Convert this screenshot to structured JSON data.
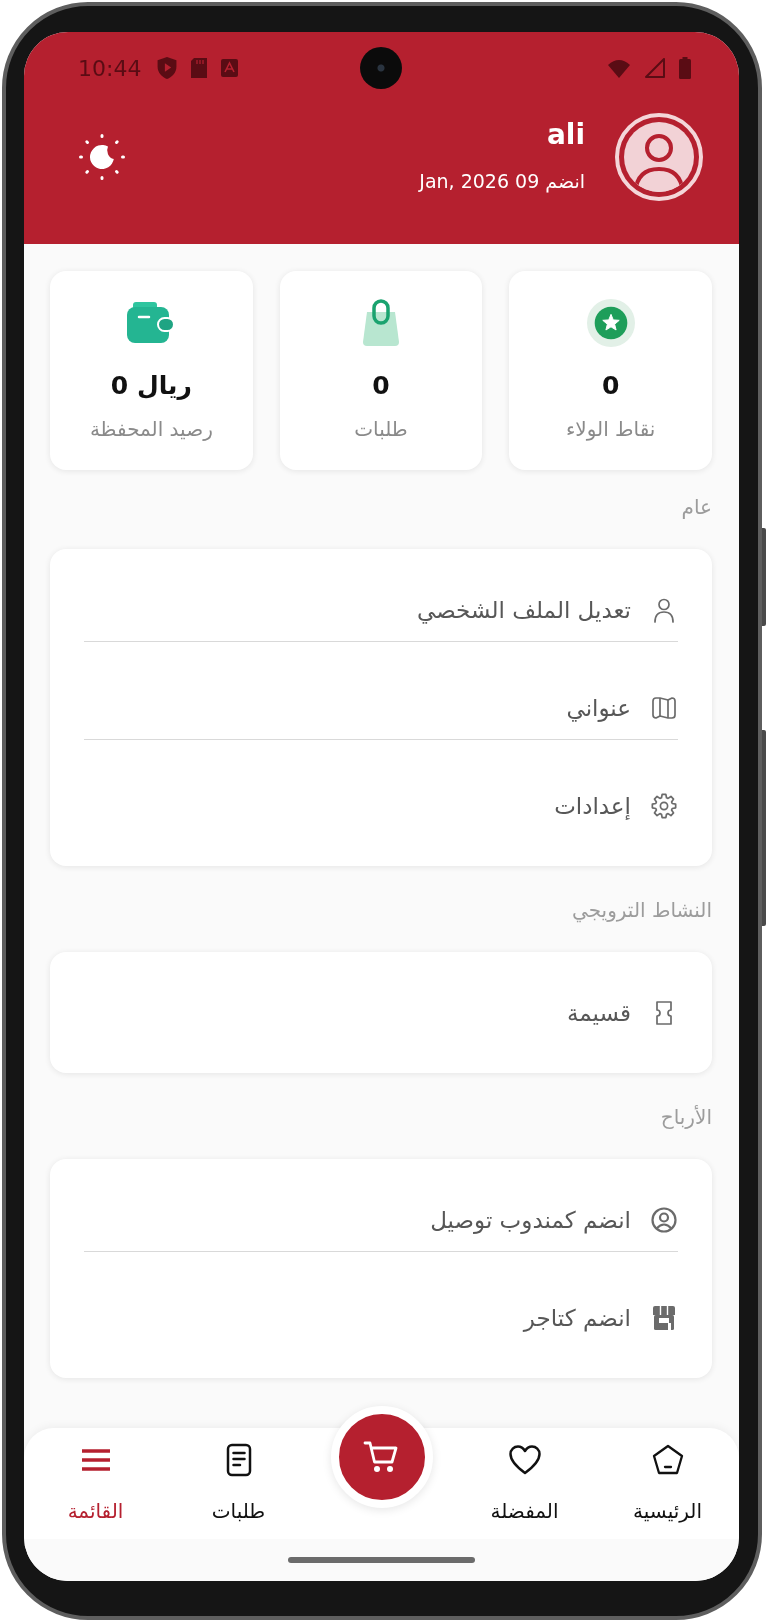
{
  "status_bar": {
    "time": "10:44"
  },
  "profile": {
    "name": "ali",
    "joined": "انضم 09 Jan, 2026"
  },
  "stats": [
    {
      "kind": "loyalty",
      "value": "0",
      "label": "نقاط الولاء"
    },
    {
      "kind": "orders",
      "value": "0",
      "label": "طلبات"
    },
    {
      "kind": "wallet",
      "value": "ريال 0",
      "label": "رصيد المحفظة"
    }
  ],
  "sections": [
    {
      "title": "عام",
      "items": [
        {
          "kind": "person",
          "label": "تعديل الملف الشخصي"
        },
        {
          "kind": "map",
          "label": "عنواني"
        },
        {
          "kind": "gear",
          "label": "إعدادات"
        }
      ]
    },
    {
      "title": "النشاط الترويجي",
      "items": [
        {
          "kind": "ticket",
          "label": "قسيمة"
        }
      ]
    },
    {
      "title": "الأرباح",
      "items": [
        {
          "kind": "person-circle",
          "label": "انضم كمندوب توصيل"
        },
        {
          "kind": "store",
          "label": "انضم كتاجر"
        }
      ]
    }
  ],
  "bottom_nav": [
    {
      "kind": "home",
      "label": "الرئيسية",
      "selected": false
    },
    {
      "kind": "favorites",
      "label": "المفضلة",
      "selected": false
    },
    {
      "kind": "orders",
      "label": "طلبات",
      "selected": false
    },
    {
      "kind": "menu",
      "label": "القائمة",
      "selected": true
    }
  ]
}
